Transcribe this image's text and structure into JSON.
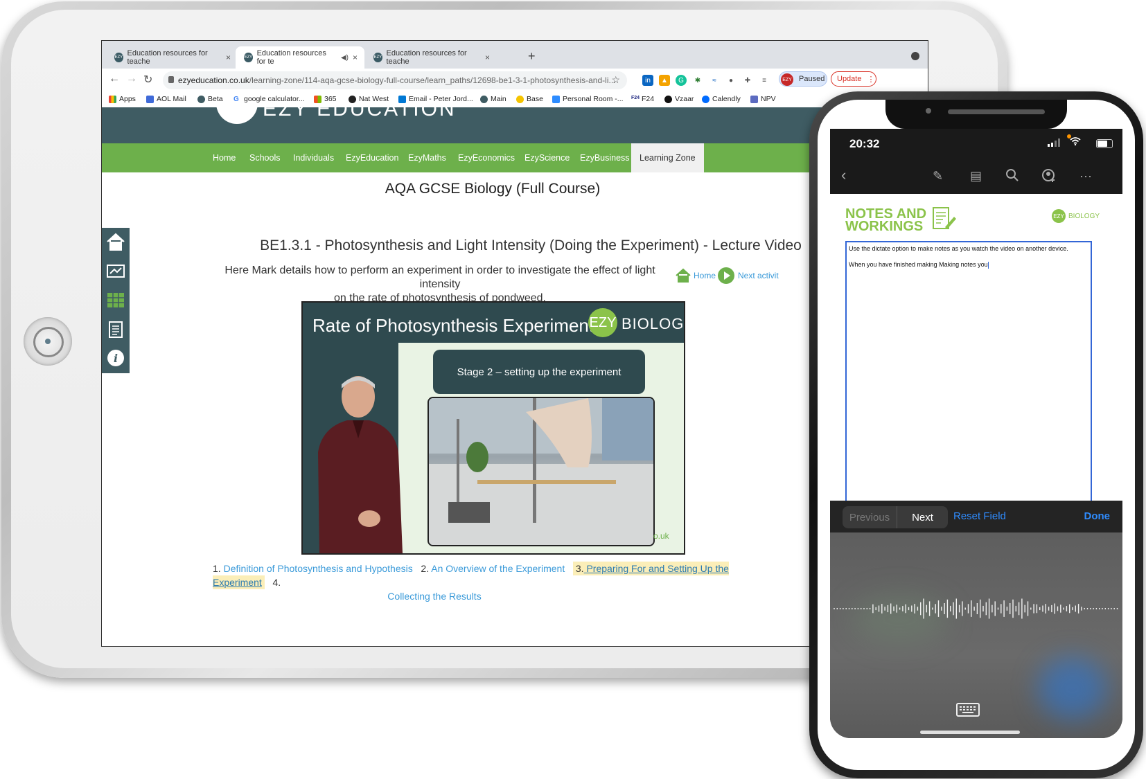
{
  "browser": {
    "tabs": [
      {
        "title": "Education resources for teache",
        "close": "×"
      },
      {
        "title": "Education resources for te",
        "close": "×"
      },
      {
        "title": "Education resources for teache",
        "close": "×"
      }
    ],
    "new_tab": "+",
    "url_domain": "ezyeducation.co.uk",
    "url_path": "/learning-zone/114-aqa-gcse-biology-full-course/learn_paths/12698-be1-3-1-photosynthesis-and-li...",
    "profile_status": "Paused",
    "profile_initials": "EZY",
    "update_label": "Update",
    "bookmarks": [
      "Apps",
      "AOL Mail",
      "Beta",
      "google calculator...",
      "365",
      "Nat West",
      "Email - Peter Jord...",
      "Main",
      "Base",
      "Personal Room -...",
      "F24",
      "Vzaar",
      "Calendly",
      "NPV"
    ],
    "colors": {
      "tabbar": "#dee1e6",
      "update": "#d93025"
    }
  },
  "site": {
    "logo_text": "EZY EDUCATION",
    "menu": [
      "Home",
      "Schools",
      "Individuals",
      "EzyEducation",
      "EzyMaths",
      "EzyEconomics",
      "EzyScience",
      "EzyBusiness",
      "Learning Zone"
    ],
    "active_menu": "Learning Zone",
    "course_title": "AQA GCSE Biology (Full Course)",
    "lecture_title": "BE1.3.1 - Photosynthesis and Light Intensity (Doing the Experiment) - Lecture Video",
    "description_line1": "Here Mark details how to perform an experiment in order to investigate the effect of light intensity",
    "description_line2": "on the rate of photosynthesis of pondweed.",
    "nav_home": "Home",
    "nav_next": "Next activit",
    "video": {
      "title": "Rate of Photosynthesis Experiment",
      "badge": "EZY",
      "badge_text": "BIOLOGY",
      "stage": "Stage 2 – setting up the experiment",
      "url_fragment": "o.uk"
    },
    "steps": [
      {
        "num": "1.",
        "label": "Definition of Photosynthesis and Hypothesis"
      },
      {
        "num": "2.",
        "label": "An Overview of the Experiment"
      },
      {
        "num": "3.",
        "label": "Preparing For and Setting Up the Experiment"
      },
      {
        "num": "4.",
        "label": "Collecting the Results"
      }
    ],
    "colors": {
      "header": "#3f5c63",
      "menu": "#6db04b",
      "link": "#3a9ad9",
      "highlight": "#fbeeb8"
    }
  },
  "phone": {
    "time": "20:32",
    "notes_title_line1": "NOTES AND",
    "notes_title_line2": "WORKINGS",
    "logo_badge": "EZY",
    "logo_text": "BIOLOGY",
    "note_line1": "Use the dictate option to make notes as you watch the video on another device.",
    "note_line2": "When you have finished making Making notes you",
    "kb_previous": "Previous",
    "kb_next": "Next",
    "kb_reset": "Reset Field",
    "kb_done": "Done",
    "colors": {
      "accent": "#2f8cff",
      "notes_green": "#8bc34a",
      "field_border": "#3366d6"
    }
  }
}
